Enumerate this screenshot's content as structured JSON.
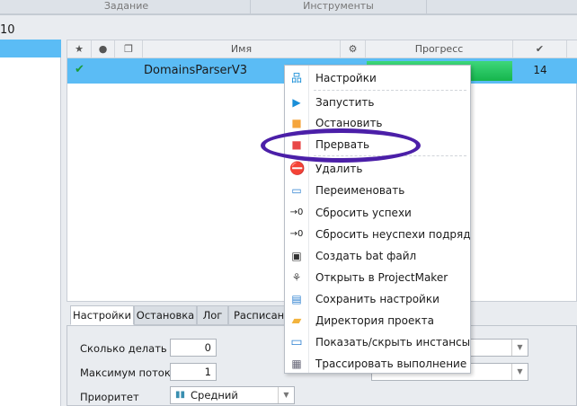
{
  "ribbon": {
    "sections": [
      "Задание",
      "Инструменты"
    ]
  },
  "counter": "10",
  "grid": {
    "columns": {
      "star": "star-icon",
      "globe": "globe-icon",
      "window": "window-icon",
      "name": "Имя",
      "gear": "gear-icon",
      "progress": "Прогресс",
      "check": "check-icon"
    },
    "rows": [
      {
        "status": "check-icon",
        "name": "DomainsParserV3",
        "progress_percent": 100,
        "success": "14"
      }
    ]
  },
  "context_menu": {
    "items": [
      {
        "label": "Настройки",
        "icon": "hierarchy-icon"
      },
      {
        "label": "Запустить",
        "icon": "play-icon"
      },
      {
        "label": "Остановить",
        "icon": "stop-orange-icon"
      },
      {
        "label": "Прервать",
        "icon": "stop-red-icon",
        "highlighted_by_annotation": true
      },
      {
        "label": "Удалить",
        "icon": "delete-icon"
      },
      {
        "label": "Переименовать",
        "icon": "rename-icon"
      },
      {
        "label": "Сбросить успехи",
        "icon": "reset-zero-icon"
      },
      {
        "label": "Сбросить неуспехи подряд",
        "icon": "reset-zero-icon"
      },
      {
        "label": "Создать bat файл",
        "icon": "console-icon"
      },
      {
        "label": "Открыть в ProjectMaker",
        "icon": "projectmaker-icon"
      },
      {
        "label": "Сохранить настройки",
        "icon": "save-icon"
      },
      {
        "label": "Директория проекта",
        "icon": "folder-icon"
      },
      {
        "label": "Показать/скрыть инстансы",
        "icon": "window-icon"
      },
      {
        "label": "Трассировать выполнение",
        "icon": "trace-icon"
      }
    ],
    "reset_glyph": "→0"
  },
  "tabs": [
    "Настройки",
    "Остановка",
    "Лог",
    "Расписание"
  ],
  "settings": {
    "count_label": "Сколько делать",
    "count_value": "0",
    "threads_label": "Максимум потоков",
    "threads_value": "1",
    "priority_label": "Приоритет",
    "priority_value": "Средний"
  },
  "colors": {
    "selection": "#5bbcf5",
    "progress": "#1fc45a",
    "annotation": "#4b1fa8"
  }
}
